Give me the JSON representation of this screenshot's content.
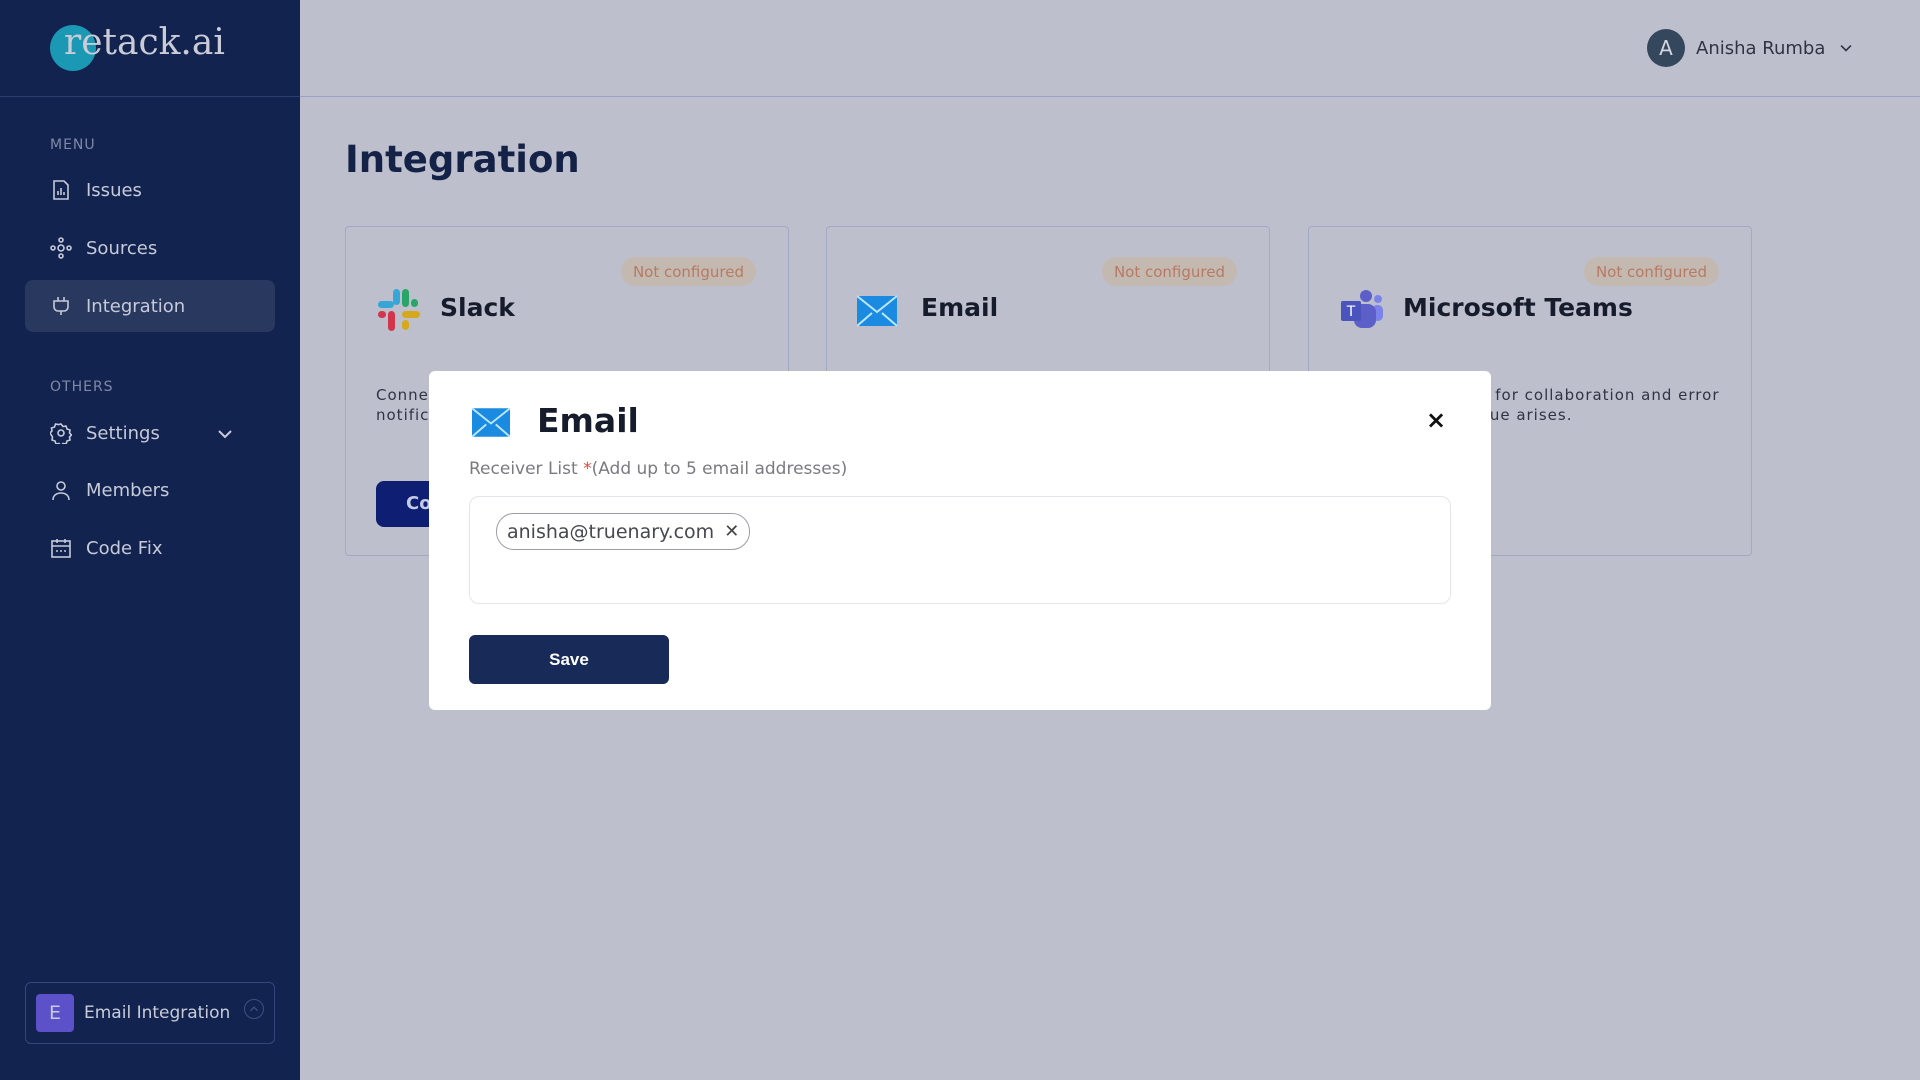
{
  "brand": {
    "logo_text": "retack.ai"
  },
  "sidebar": {
    "menu_label": "MENU",
    "menu_items": [
      {
        "label": "Issues",
        "icon": "chart-document-icon"
      },
      {
        "label": "Sources",
        "icon": "nodes-icon"
      },
      {
        "label": "Integration",
        "icon": "plug-icon",
        "active": true
      }
    ],
    "others_label": "OTHERS",
    "other_items": [
      {
        "label": "Settings",
        "icon": "gear-icon"
      },
      {
        "label": "Members",
        "icon": "user-icon"
      },
      {
        "label": "Code Fix",
        "icon": "calendar-icon"
      }
    ],
    "workspace": {
      "initial": "E",
      "name": "Email Integration"
    }
  },
  "header": {
    "user_initial": "A",
    "user_name": "Anisha Rumba"
  },
  "page": {
    "title": "Integration"
  },
  "cards": [
    {
      "name": "Slack",
      "status": "Not configured",
      "desc_line1": "Conne",
      "desc_line2": "notific",
      "button": "Co"
    },
    {
      "name": "Email",
      "status": "Not configured"
    },
    {
      "name": "Microsoft Teams",
      "status": "Not configured",
      "desc_line1": "n for collaboration and error",
      "desc_line2": "sue arises."
    }
  ],
  "modal": {
    "title": "Email",
    "label": "Receiver List ",
    "required_mark": "*",
    "hint": "(Add up to 5 email addresses)",
    "emails": [
      "anisha@truenary.com"
    ],
    "save_label": "Save",
    "close_label": "×"
  },
  "colors": {
    "sidebar": "#12234f",
    "primary_button": "#172a58",
    "badge_text": "#b77a63",
    "workspace_avatar": "#5c51c9"
  }
}
